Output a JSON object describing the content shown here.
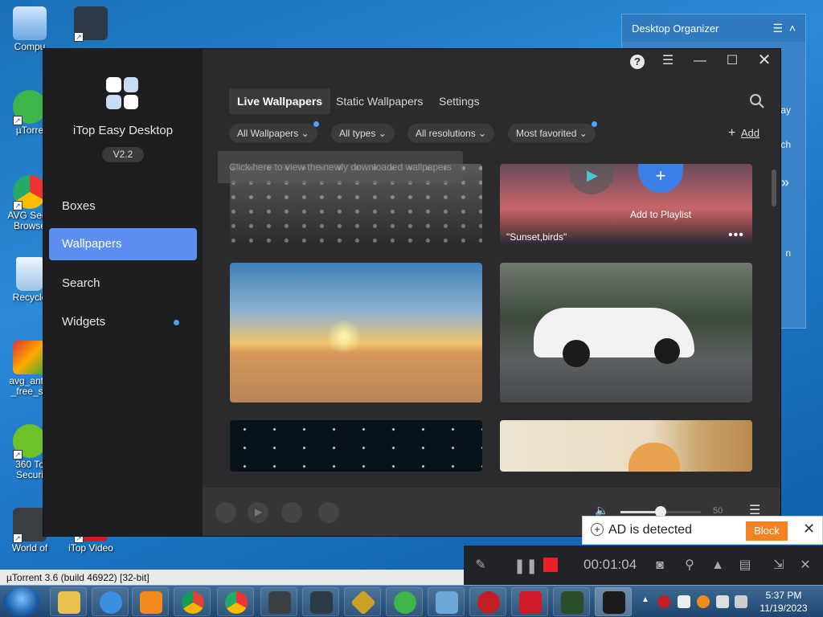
{
  "desktop": {
    "icons": [
      {
        "label": "Compu"
      },
      {
        "label": ""
      },
      {
        "label": "µTorre"
      },
      {
        "label": "AVG Secu\nBrowse"
      },
      {
        "label": "Recycle"
      },
      {
        "label": "avg_antiv\n_free_se"
      },
      {
        "label": "360 To\nSecuri"
      },
      {
        "label": "World of"
      },
      {
        "label": "iTop Video"
      }
    ]
  },
  "organizer": {
    "title": "Desktop Organizer",
    "fragments": [
      "ay",
      "ch",
      "n"
    ]
  },
  "app": {
    "name": "iTop Easy Desktop",
    "version": "V2.2",
    "nav": [
      {
        "label": "Boxes",
        "active": false
      },
      {
        "label": "Wallpapers",
        "active": true
      },
      {
        "label": "Search",
        "active": false
      },
      {
        "label": "Widgets",
        "active": false,
        "dot": true
      }
    ],
    "tabs": [
      {
        "label": "Live Wallpapers",
        "active": true
      },
      {
        "label": "Static Wallpapers",
        "active": false
      },
      {
        "label": "Settings",
        "active": false
      }
    ],
    "filters": [
      {
        "label": "All Wallpapers",
        "dot": true
      },
      {
        "label": "All types",
        "dot": false
      },
      {
        "label": "All resolutions",
        "dot": false
      },
      {
        "label": "Most favorited",
        "dot": true
      }
    ],
    "add_label": "Add",
    "tooltip": "Click here to view the newly downloaded wallpapers",
    "thumbs": [
      {
        "name": "rain-window"
      },
      {
        "name": "sunset-birds",
        "caption": "\"Sunset,birds\"",
        "hover_label": "Add to Playlist"
      },
      {
        "name": "desert-sunset"
      },
      {
        "name": "white-sportscar"
      },
      {
        "name": "starry-night"
      },
      {
        "name": "kitten"
      }
    ],
    "player": {
      "volume_value": "50",
      "volume_level": 0.5
    }
  },
  "ad_bar": {
    "text": "AD is detected",
    "block_label": "Block"
  },
  "recorder": {
    "time": "00:01:04"
  },
  "status_bar": {
    "text": "µTorrent 3.6  (build 46922) [32-bit]"
  },
  "taskbar": {
    "time": "5:37 PM",
    "date": "11/19/2023"
  }
}
